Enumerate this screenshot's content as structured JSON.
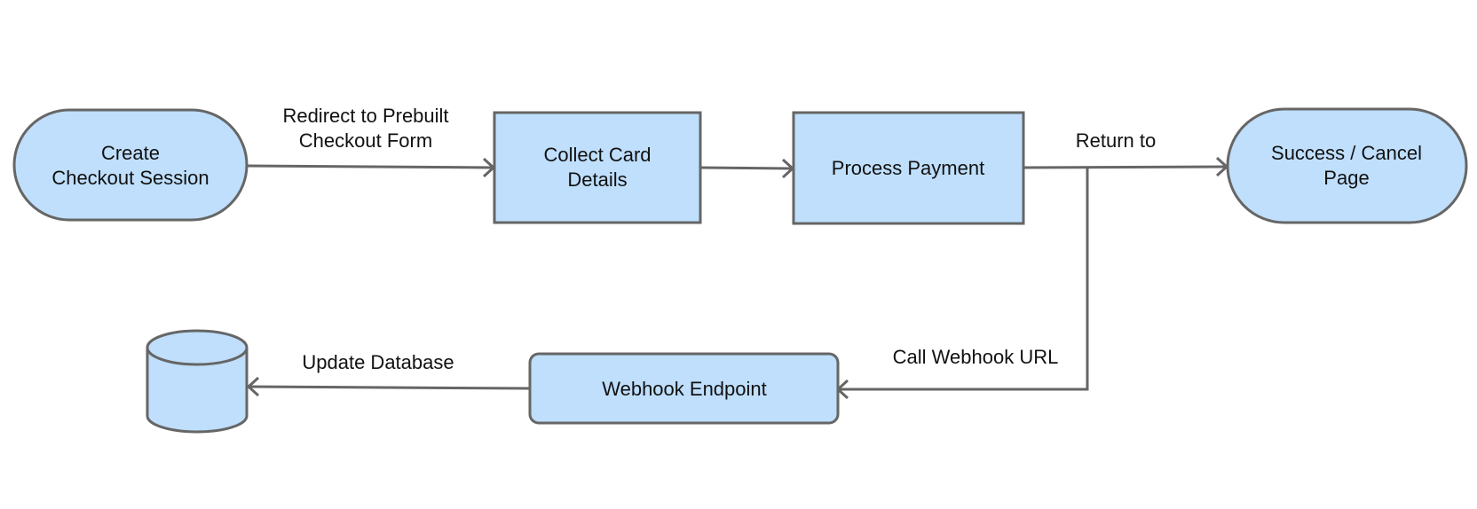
{
  "diagram": {
    "type": "flowchart",
    "colors": {
      "node_fill": "#bfdffc",
      "stroke": "#666666",
      "text": "#111111",
      "background": "#ffffff"
    },
    "nodes": [
      {
        "id": "create-session",
        "shape": "stadium",
        "lines": [
          "Create",
          "Checkout Session"
        ]
      },
      {
        "id": "collect-card",
        "shape": "rectangle",
        "lines": [
          "Collect Card",
          "Details"
        ]
      },
      {
        "id": "process-payment",
        "shape": "rectangle",
        "lines": [
          "Process Payment"
        ]
      },
      {
        "id": "success-cancel",
        "shape": "stadium",
        "lines": [
          "Success / Cancel",
          "Page"
        ]
      },
      {
        "id": "webhook-endpoint",
        "shape": "rounded-rectangle",
        "lines": [
          "Webhook Endpoint"
        ]
      },
      {
        "id": "database",
        "shape": "cylinder",
        "lines": []
      }
    ],
    "edges": [
      {
        "from": "create-session",
        "to": "collect-card",
        "label_lines": [
          "Redirect to  Prebuilt",
          "Checkout Form"
        ]
      },
      {
        "from": "collect-card",
        "to": "process-payment",
        "label_lines": []
      },
      {
        "from": "process-payment",
        "to": "success-cancel",
        "label_lines": [
          "Return to"
        ]
      },
      {
        "from": "process-payment",
        "to": "webhook-endpoint",
        "label_lines": [
          "Call Webhook URL"
        ]
      },
      {
        "from": "webhook-endpoint",
        "to": "database",
        "label_lines": [
          "Update Database"
        ]
      }
    ]
  }
}
